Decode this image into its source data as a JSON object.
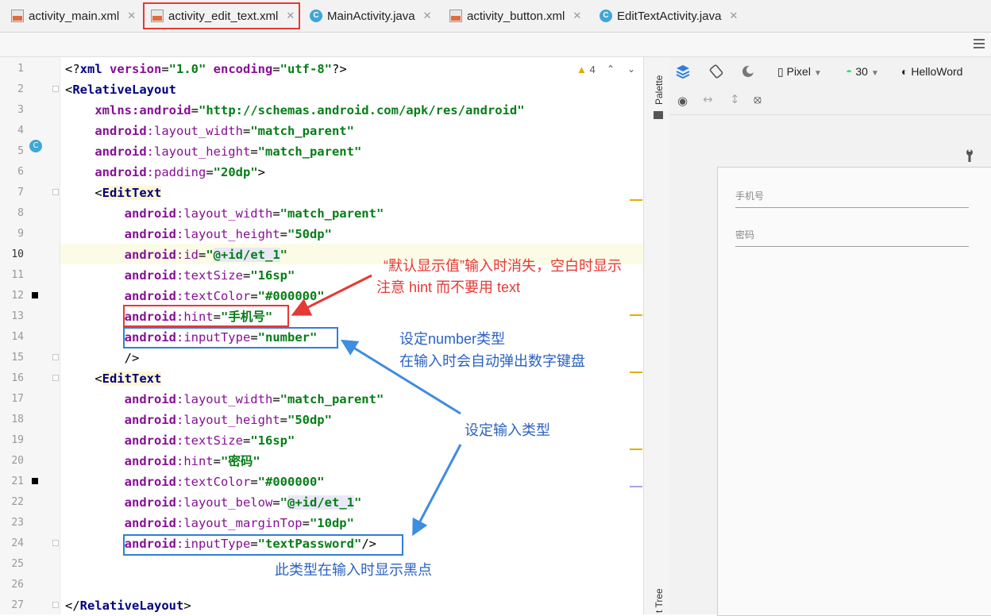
{
  "tabs": [
    {
      "label": "activity_main.xml",
      "type": "xml"
    },
    {
      "label": "activity_edit_text.xml",
      "type": "xml",
      "active": true
    },
    {
      "label": "MainActivity.java",
      "type": "java"
    },
    {
      "label": "activity_button.xml",
      "type": "xml"
    },
    {
      "label": "EditTextActivity.java",
      "type": "java"
    }
  ],
  "editor": {
    "warning_count": "4",
    "current_line": 10,
    "lines": [
      {
        "n": "1",
        "seg": [
          [
            "p",
            "<?"
          ],
          [
            "tag",
            "xml "
          ],
          [
            "ns",
            "version"
          ],
          [
            "p",
            "="
          ],
          [
            "str",
            "\"1.0\" "
          ],
          [
            "ns",
            "encoding"
          ],
          [
            "p",
            "="
          ],
          [
            "str",
            "\"utf-8\""
          ],
          [
            "p",
            "?>"
          ]
        ]
      },
      {
        "n": "2",
        "seg": [
          [
            "p",
            "<"
          ],
          [
            "tag",
            "RelativeLayout"
          ]
        ]
      },
      {
        "n": "3",
        "seg": [
          [
            "p",
            "    "
          ],
          [
            "ns",
            "xmlns:android"
          ],
          [
            "p",
            "="
          ],
          [
            "str",
            "\"http://schemas.android.com/apk/res/android\""
          ]
        ]
      },
      {
        "n": "4",
        "seg": [
          [
            "p",
            "    "
          ],
          [
            "ns",
            "android"
          ],
          [
            "attr",
            ":layout_width"
          ],
          [
            "p",
            "="
          ],
          [
            "str",
            "\"match_parent\""
          ]
        ]
      },
      {
        "n": "5",
        "seg": [
          [
            "p",
            "    "
          ],
          [
            "ns",
            "android"
          ],
          [
            "attr",
            ":layout_height"
          ],
          [
            "p",
            "="
          ],
          [
            "str",
            "\"match_parent\""
          ]
        ]
      },
      {
        "n": "6",
        "seg": [
          [
            "p",
            "    "
          ],
          [
            "ns",
            "android"
          ],
          [
            "attr",
            ":padding"
          ],
          [
            "p",
            "="
          ],
          [
            "str",
            "\"20dp\""
          ],
          [
            "p",
            ">"
          ]
        ]
      },
      {
        "n": "7",
        "seg": [
          [
            "p",
            "    <"
          ],
          [
            "tagbg",
            "EditText"
          ]
        ]
      },
      {
        "n": "8",
        "seg": [
          [
            "p",
            "        "
          ],
          [
            "ns",
            "android"
          ],
          [
            "attr",
            ":layout_width"
          ],
          [
            "p",
            "="
          ],
          [
            "str",
            "\"match_parent\""
          ]
        ]
      },
      {
        "n": "9",
        "seg": [
          [
            "p",
            "        "
          ],
          [
            "ns",
            "android"
          ],
          [
            "attr",
            ":layout_height"
          ],
          [
            "p",
            "="
          ],
          [
            "str",
            "\"50dp\""
          ]
        ]
      },
      {
        "n": "10",
        "seg": [
          [
            "p",
            "        "
          ],
          [
            "ns",
            "android"
          ],
          [
            "attr",
            ":id"
          ],
          [
            "p",
            "="
          ],
          [
            "str",
            "\""
          ],
          [
            "idbg",
            "@+id/et_1"
          ],
          [
            "str",
            "\""
          ]
        ]
      },
      {
        "n": "11",
        "seg": [
          [
            "p",
            "        "
          ],
          [
            "ns",
            "android"
          ],
          [
            "attr",
            ":textSize"
          ],
          [
            "p",
            "="
          ],
          [
            "str",
            "\"16sp\""
          ]
        ]
      },
      {
        "n": "12",
        "seg": [
          [
            "p",
            "        "
          ],
          [
            "ns",
            "android"
          ],
          [
            "attr",
            ":textColor"
          ],
          [
            "p",
            "="
          ],
          [
            "str",
            "\"#000000\""
          ]
        ]
      },
      {
        "n": "13",
        "seg": [
          [
            "p",
            "        "
          ],
          [
            "ns",
            "android"
          ],
          [
            "attr",
            ":hint"
          ],
          [
            "p",
            "="
          ],
          [
            "str",
            "\"手机号\""
          ]
        ]
      },
      {
        "n": "14",
        "seg": [
          [
            "p",
            "        "
          ],
          [
            "ns",
            "android"
          ],
          [
            "attr",
            ":inputType"
          ],
          [
            "p",
            "="
          ],
          [
            "str",
            "\"number\""
          ]
        ]
      },
      {
        "n": "15",
        "seg": [
          [
            "p",
            "        />"
          ]
        ]
      },
      {
        "n": "16",
        "seg": [
          [
            "p",
            "    <"
          ],
          [
            "tagbg",
            "EditText"
          ]
        ]
      },
      {
        "n": "17",
        "seg": [
          [
            "p",
            "        "
          ],
          [
            "ns",
            "android"
          ],
          [
            "attr",
            ":layout_width"
          ],
          [
            "p",
            "="
          ],
          [
            "str",
            "\"match_parent\""
          ]
        ]
      },
      {
        "n": "18",
        "seg": [
          [
            "p",
            "        "
          ],
          [
            "ns",
            "android"
          ],
          [
            "attr",
            ":layout_height"
          ],
          [
            "p",
            "="
          ],
          [
            "str",
            "\"50dp\""
          ]
        ]
      },
      {
        "n": "19",
        "seg": [
          [
            "p",
            "        "
          ],
          [
            "ns",
            "android"
          ],
          [
            "attr",
            ":textSize"
          ],
          [
            "p",
            "="
          ],
          [
            "str",
            "\"16sp\""
          ]
        ]
      },
      {
        "n": "20",
        "seg": [
          [
            "p",
            "        "
          ],
          [
            "ns",
            "android"
          ],
          [
            "attr",
            ":hint"
          ],
          [
            "p",
            "="
          ],
          [
            "str",
            "\"密码\""
          ]
        ]
      },
      {
        "n": "21",
        "seg": [
          [
            "p",
            "        "
          ],
          [
            "ns",
            "android"
          ],
          [
            "attr",
            ":textColor"
          ],
          [
            "p",
            "="
          ],
          [
            "str",
            "\"#000000\""
          ]
        ]
      },
      {
        "n": "22",
        "seg": [
          [
            "p",
            "        "
          ],
          [
            "ns",
            "android"
          ],
          [
            "attr",
            ":layout_below"
          ],
          [
            "p",
            "="
          ],
          [
            "str",
            "\""
          ],
          [
            "idbg",
            "@+id/et_1"
          ],
          [
            "str",
            "\""
          ]
        ]
      },
      {
        "n": "23",
        "seg": [
          [
            "p",
            "        "
          ],
          [
            "ns",
            "android"
          ],
          [
            "attr",
            ":layout_marginTop"
          ],
          [
            "p",
            "="
          ],
          [
            "str",
            "\"10dp\""
          ]
        ]
      },
      {
        "n": "24",
        "seg": [
          [
            "p",
            "        "
          ],
          [
            "ns",
            "android"
          ],
          [
            "attr",
            ":inputType"
          ],
          [
            "p",
            "="
          ],
          [
            "str",
            "\"textPassword\""
          ],
          [
            "p",
            "/>"
          ]
        ]
      },
      {
        "n": "25",
        "seg": []
      },
      {
        "n": "26",
        "seg": []
      },
      {
        "n": "27",
        "seg": [
          [
            "p",
            "</"
          ],
          [
            "tag",
            "RelativeLayout"
          ],
          [
            "p",
            ">"
          ]
        ]
      }
    ]
  },
  "annotations": {
    "hint_note_1": "“默认显示值”输入时消失，空白时显示",
    "hint_note_2": "注意 hint 而不要用 text",
    "number_note_1": "设定number类型",
    "number_note_2": "在输入时会自动弹出数字键盘",
    "input_type_note": "设定输入类型",
    "password_note": "此类型在输入时显示黑点"
  },
  "side_panel": {
    "palette": "Palette",
    "tree": "t Tree"
  },
  "design": {
    "device": "Pixel",
    "api_level": "30",
    "theme": "HelloWord",
    "preview_hint_1": "手机号",
    "preview_hint_2": "密码"
  },
  "colors": {
    "highlight_red": "#e53935",
    "highlight_blue": "#2f7fd9",
    "string": "#067d17",
    "namespace": "#871094"
  }
}
